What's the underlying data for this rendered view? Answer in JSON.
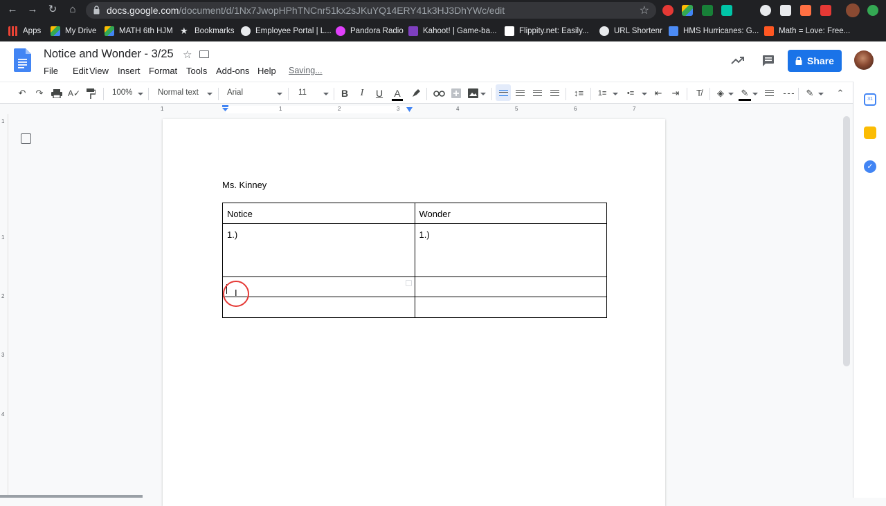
{
  "browser": {
    "url_domain": "docs.google.com",
    "url_path": "/document/d/1Nx7JwopHPhTNCnr51kx2sJKuYQ14ERY41k3HJ3DhYWc/edit",
    "bookmarks": [
      {
        "label": "Apps",
        "icon": "apps-grid-icon",
        "color": "#ea4335"
      },
      {
        "label": "My Drive",
        "icon": "google-drive-icon",
        "color": "#fbbc04"
      },
      {
        "label": "MATH 6th HJM",
        "icon": "google-drive-icon",
        "color": "#fbbc04"
      },
      {
        "label": "Bookmarks",
        "icon": "star-icon",
        "color": "#e8eaed"
      },
      {
        "label": "Employee Portal | L...",
        "icon": "globe-icon",
        "color": "#e8eaed"
      },
      {
        "label": "Pandora Radio",
        "icon": "pandora-icon",
        "color": "#e040fb"
      },
      {
        "label": "Kahoot! | Game-ba...",
        "icon": "kahoot-icon",
        "color": "#7e3fbf"
      },
      {
        "label": "Flippity.net: Easily...",
        "icon": "flippity-icon",
        "color": "#ffffff"
      },
      {
        "label": "URL Shortenr",
        "icon": "globe-icon",
        "color": "#e8eaed"
      },
      {
        "label": "HMS Hurricanes: G...",
        "icon": "weebly-icon",
        "color": "#4c8bf5"
      },
      {
        "label": "Math = Love: Free...",
        "icon": "blogger-icon",
        "color": "#ff5722"
      }
    ]
  },
  "doc": {
    "title": "Notice and Wonder - 3/25",
    "menu": [
      "File",
      "Edit",
      "View",
      "Insert",
      "Format",
      "Tools",
      "Add-ons",
      "Help"
    ],
    "status": "Saving...",
    "share_label": "Share"
  },
  "toolbar": {
    "zoom": "100%",
    "style": "Normal text",
    "font": "Arial",
    "font_size": "11",
    "bold": "B",
    "italic": "I",
    "underline": "U",
    "text_color_letter": "A"
  },
  "ruler": {
    "marks": [
      "1",
      "1",
      "2",
      "3",
      "4",
      "5",
      "6",
      "7"
    ]
  },
  "vruler": {
    "marks": [
      "1",
      "1",
      "2",
      "3",
      "4"
    ]
  },
  "page": {
    "teacher": "Ms. Kinney",
    "table": {
      "headers": [
        "Notice",
        "Wonder"
      ],
      "rows": [
        [
          "1.)",
          "1.)"
        ],
        [
          "",
          ""
        ],
        [
          "",
          ""
        ]
      ]
    }
  },
  "colors": {
    "accent": "#1a73e8",
    "chrome_bg": "#202124"
  }
}
